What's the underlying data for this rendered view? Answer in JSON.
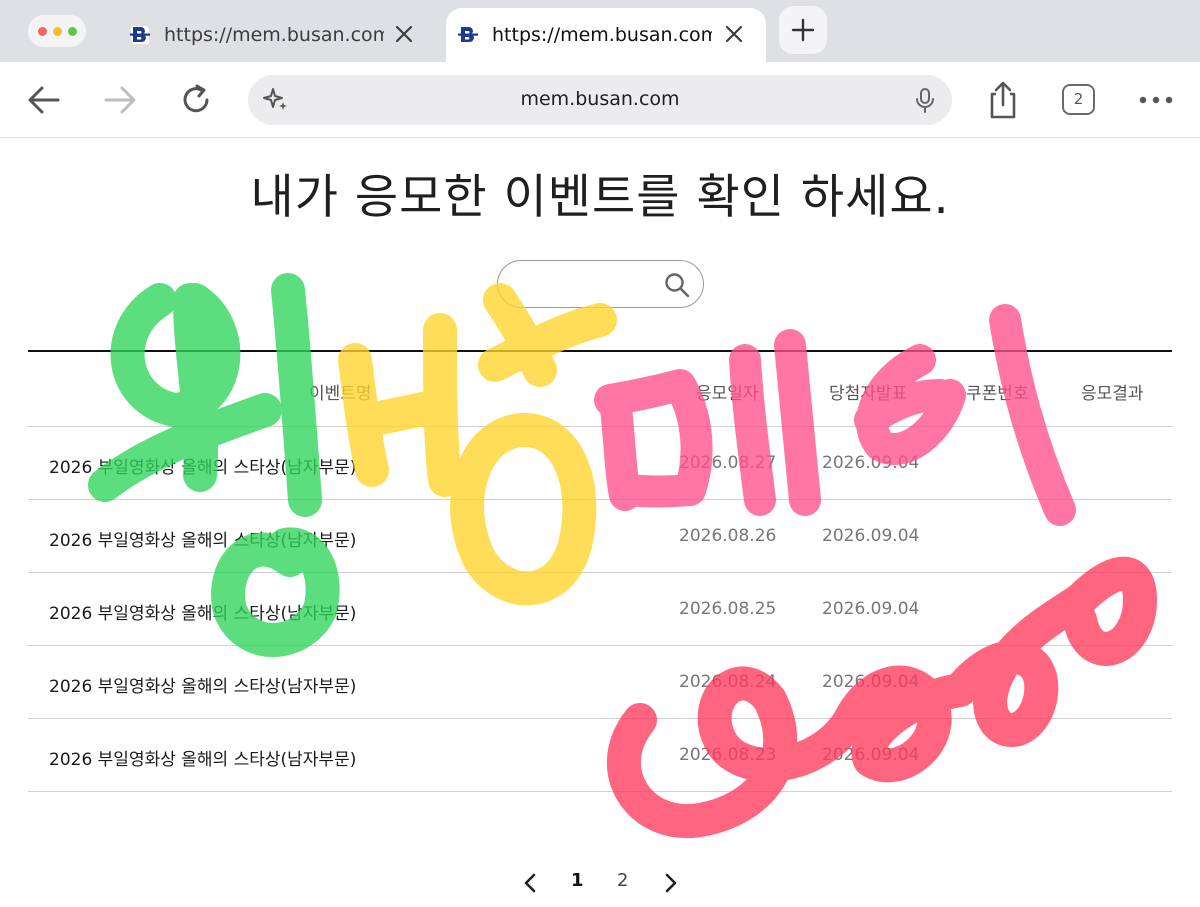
{
  "browser": {
    "tabs": [
      {
        "title": "https://mem.busan.com/",
        "active": false
      },
      {
        "title": "https://mem.busan.com/",
        "active": true
      }
    ],
    "address": "mem.busan.com",
    "tab_count": "2",
    "colors": {
      "tab_strip": "#dfe0e4",
      "address_bar": "#ececee",
      "favicon": "#1e3a8a"
    }
  },
  "page": {
    "title": "내가 응모한 이벤트를 확인 하세요.",
    "search": {
      "value": "",
      "placeholder": ""
    },
    "table": {
      "headers": {
        "event_name": "이벤트명",
        "apply_date": "응모일자",
        "winner_date": "당첨자발표",
        "coupon": "쿠폰번호",
        "result": "응모결과"
      },
      "rows": [
        {
          "event_name": "2026 부일영화상 올해의 스타상(남자부문)",
          "apply_date": "2026.08.27",
          "winner_date": "2026.09.04",
          "coupon": "",
          "result": ""
        },
        {
          "event_name": "2026 부일영화상 올해의 스타상(남자부문)",
          "apply_date": "2026.08.26",
          "winner_date": "2026.09.04",
          "coupon": "",
          "result": ""
        },
        {
          "event_name": "2026 부일영화상 올해의 스타상(남자부문)",
          "apply_date": "2026.08.25",
          "winner_date": "2026.09.04",
          "coupon": "",
          "result": ""
        },
        {
          "event_name": "2026 부일영화상 올해의 스타상(남자부문)",
          "apply_date": "2026.08.24",
          "winner_date": "2026.09.04",
          "coupon": "",
          "result": ""
        },
        {
          "event_name": "2026 부일영화상 올해의 스타상(남자부문)",
          "apply_date": "2026.08.23",
          "winner_date": "2026.09.04",
          "coupon": "",
          "result": ""
        }
      ]
    },
    "pagination": {
      "pages": [
        "1",
        "2"
      ],
      "current": "1"
    }
  },
  "overlay": {
    "handwriting": "원빈 오메이",
    "colors": {
      "green": "#2fd45a",
      "yellow": "#ffd42a",
      "pink": "#ff4f8a",
      "red": "#ff3a5c"
    }
  }
}
